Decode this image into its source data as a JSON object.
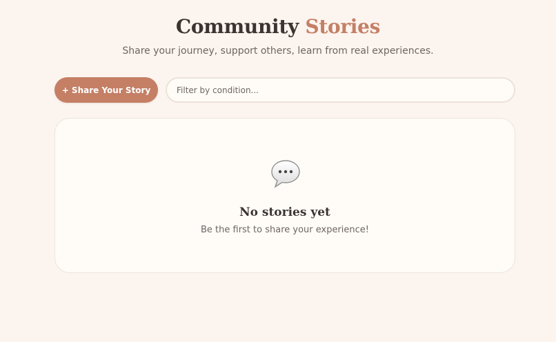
{
  "header": {
    "title_main": "Community",
    "title_accent": "Stories",
    "subtitle": "Share your journey, support others, learn from real experiences."
  },
  "toolbar": {
    "share_label": "+ Share Your Story",
    "filter_placeholder": "Filter by condition...",
    "filter_value": ""
  },
  "empty_state": {
    "icon": "speech-bubble-icon",
    "title": "No stories yet",
    "message": "Be the first to share your experience!"
  },
  "colors": {
    "background": "#fcf4ef",
    "accent": "#c47f65",
    "card": "#fffcf7",
    "text": "#3b3431",
    "muted_text": "#6e6561"
  }
}
